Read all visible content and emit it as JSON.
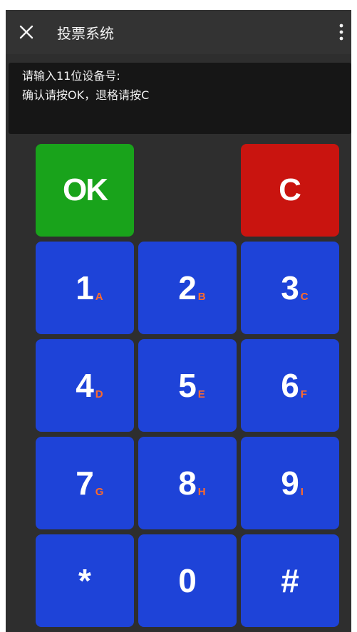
{
  "titlebar": {
    "title": "投票系统",
    "close_icon": "close-icon",
    "more_icon": "more-vertical-icon"
  },
  "display": {
    "line1": "请输入11位设备号:",
    "line2": "确认请按OK，退格请按C"
  },
  "keypad": {
    "ok": "OK",
    "cancel": "C",
    "keys": [
      {
        "digit": "1",
        "letter": "A"
      },
      {
        "digit": "2",
        "letter": "B"
      },
      {
        "digit": "3",
        "letter": "C"
      },
      {
        "digit": "4",
        "letter": "D"
      },
      {
        "digit": "5",
        "letter": "E"
      },
      {
        "digit": "6",
        "letter": "F"
      },
      {
        "digit": "7",
        "letter": "G"
      },
      {
        "digit": "8",
        "letter": "H"
      },
      {
        "digit": "9",
        "letter": "I"
      },
      {
        "digit": "*",
        "letter": ""
      },
      {
        "digit": "0",
        "letter": ""
      },
      {
        "digit": "#",
        "letter": ""
      }
    ]
  },
  "colors": {
    "ok": "#19a31b",
    "cancel": "#c9140f",
    "key": "#1e43d8",
    "letter": "#ff6a2b",
    "background": "#2e2e2e"
  }
}
